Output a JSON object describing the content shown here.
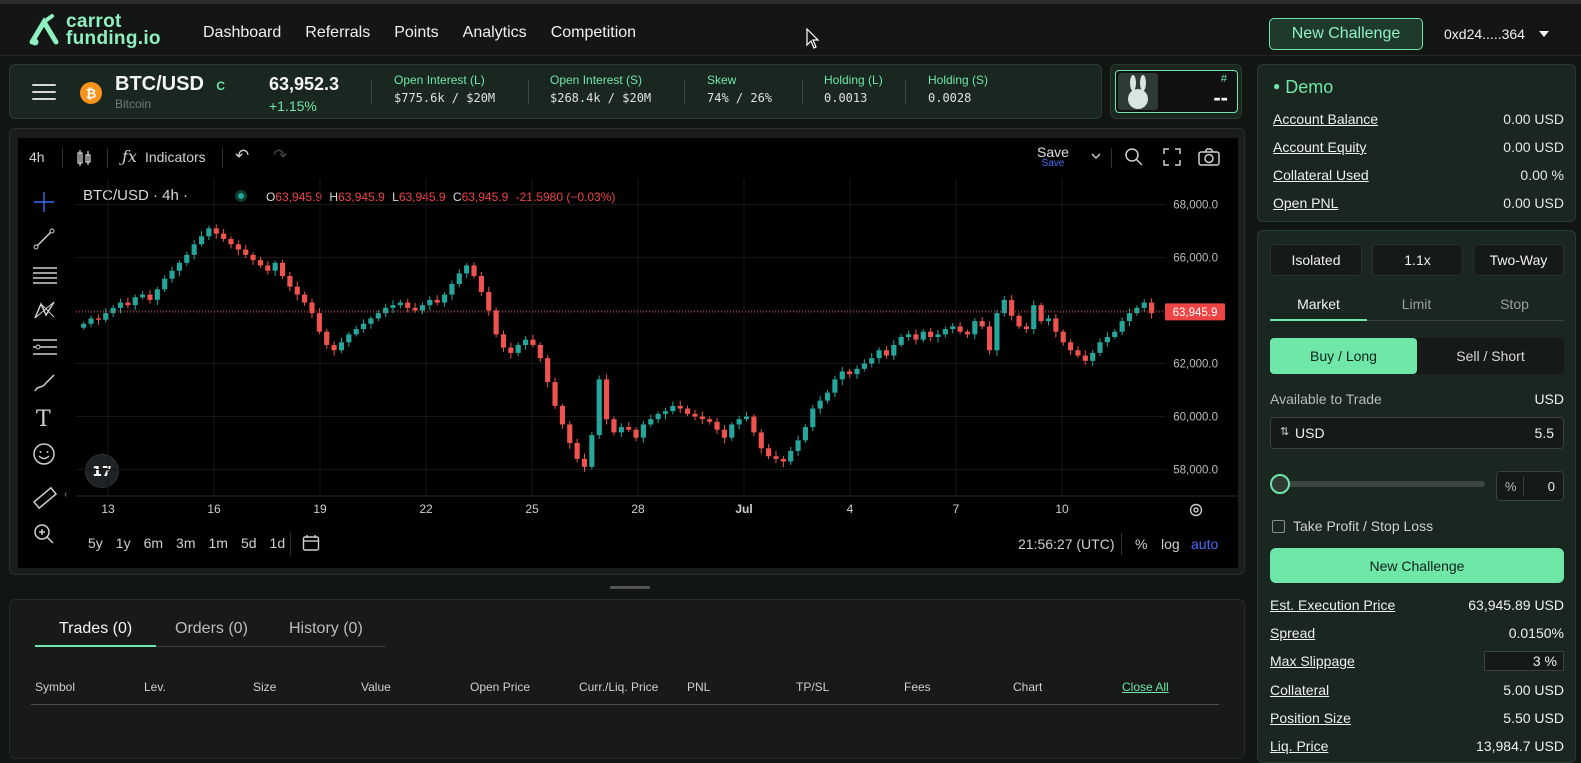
{
  "brand": {
    "line1": "carrot",
    "line2": "funding.io"
  },
  "nav": [
    "Dashboard",
    "Referrals",
    "Points",
    "Analytics",
    "Competition"
  ],
  "header": {
    "new_challenge": "New Challenge",
    "wallet": "0xd24.....364"
  },
  "ticker": {
    "symbol": "BTC/USD",
    "tag": "C",
    "name": "Bitcoin",
    "price": "63,952.3",
    "change": "+1.15%",
    "stats": [
      {
        "label": "Open Interest (L)",
        "value": "$775.6k / $20M"
      },
      {
        "label": "Open Interest (S)",
        "value": "$268.4k / $20M"
      },
      {
        "label": "Skew",
        "value": "74% / 26%"
      },
      {
        "label": "Holding (L)",
        "value": "0.0013"
      },
      {
        "label": "Holding (S)",
        "value": "0.0028"
      }
    ]
  },
  "rank": {
    "hash": "#",
    "value": "--"
  },
  "chart_toolbar": {
    "interval": "4h",
    "indicators": "Indicators",
    "save": "Save",
    "save_sub": "Save"
  },
  "chart_data": {
    "type": "candlestick",
    "symbol_line": "BTC/USD · 4h ·",
    "ohlc": {
      "o_label": "O",
      "o": "63,945.9",
      "h_label": "H",
      "h": "63,945.9",
      "l_label": "L",
      "l": "63,945.9",
      "c_label": "C",
      "c": "63,945.9",
      "chg": "-21.5980 (−0.03%)"
    },
    "y_ticks": [
      "68,000.0",
      "66,000.0",
      "64,000.0",
      "62,000.0",
      "60,000.0",
      "58,000.0"
    ],
    "y_tick_values": [
      68000,
      66000,
      64000,
      62000,
      60000,
      58000
    ],
    "ylim": [
      57000,
      69000
    ],
    "x_ticks": [
      "13",
      "16",
      "19",
      "22",
      "25",
      "28",
      "Jul",
      "4",
      "7",
      "10"
    ],
    "last_price": "63,945.9",
    "last_price_value": 63945.9,
    "up_color": "#26a69a",
    "down_color": "#ef5350",
    "series_close": [
      63500,
      63700,
      63650,
      63900,
      64100,
      64300,
      64200,
      64500,
      64600,
      64400,
      64800,
      65200,
      65500,
      65800,
      66100,
      66500,
      66800,
      67100,
      66900,
      66700,
      66500,
      66300,
      66100,
      65900,
      65700,
      65500,
      65800,
      65300,
      64900,
      64600,
      64300,
      63900,
      63200,
      62700,
      62500,
      62800,
      63100,
      63300,
      63500,
      63700,
      63900,
      64100,
      64200,
      64300,
      64100,
      64000,
      64200,
      64400,
      64300,
      64600,
      65000,
      65400,
      65700,
      65300,
      64700,
      64000,
      63100,
      62600,
      62400,
      62700,
      62900,
      62700,
      62200,
      61300,
      60400,
      59700,
      59000,
      58400,
      58100,
      59300,
      61400,
      59900,
      59400,
      59600,
      59500,
      59200,
      59700,
      59900,
      60100,
      60200,
      60400,
      60300,
      60100,
      60000,
      59900,
      59800,
      59500,
      59200,
      59700,
      59900,
      60000,
      59400,
      58800,
      58500,
      58400,
      58300,
      58700,
      59100,
      59600,
      60300,
      60600,
      60900,
      61400,
      61700,
      61600,
      61800,
      62000,
      62200,
      62500,
      62300,
      62700,
      63000,
      63100,
      62900,
      63200,
      63000,
      63100,
      63300,
      63400,
      63200,
      63100,
      63600,
      63400,
      62500,
      63900,
      64400,
      63800,
      63400,
      63300,
      64200,
      63600,
      63700,
      63200,
      62800,
      62500,
      62300,
      62100,
      62400,
      62800,
      63000,
      63200,
      63600,
      63900,
      64100,
      64300,
      63900
    ]
  },
  "ranges": [
    "5y",
    "1y",
    "6m",
    "3m",
    "1m",
    "5d",
    "1d"
  ],
  "chart_footer": {
    "time": "21:56:27 (UTC)",
    "pct": "%",
    "log": "log",
    "auto": "auto"
  },
  "account": {
    "mode": "Demo",
    "rows": [
      {
        "k": "Account Balance",
        "v": "0.00 USD"
      },
      {
        "k": "Account Equity",
        "v": "0.00 USD"
      },
      {
        "k": "Collateral Used",
        "v": "0.00 %"
      },
      {
        "k": "Open PNL",
        "v": "0.00 USD"
      }
    ]
  },
  "order": {
    "margin": "Isolated",
    "leverage": "1.1x",
    "mode": "Two-Way",
    "tabs": [
      "Market",
      "Limit",
      "Stop"
    ],
    "buy": "Buy / Long",
    "sell": "Sell / Short",
    "available_label": "Available to Trade",
    "available_unit": "USD",
    "input_unit": "USD",
    "input_value": "5.5",
    "pct_symbol": "%",
    "pct_value": "0",
    "tpsl": "Take Profit / Stop Loss",
    "submit": "New Challenge",
    "details": [
      {
        "k": "Est. Execution Price",
        "v": "63,945.89 USD"
      },
      {
        "k": "Spread",
        "v": "0.0150%"
      },
      {
        "k": "Max Slippage",
        "v": "3 %"
      },
      {
        "k": "Collateral",
        "v": "5.00 USD"
      },
      {
        "k": "Position Size",
        "v": "5.50 USD"
      },
      {
        "k": "Liq. Price",
        "v": "13,984.7 USD"
      }
    ]
  },
  "trades": {
    "tabs": [
      "Trades (0)",
      "Orders (0)",
      "History (0)"
    ],
    "columns": [
      "Symbol",
      "Lev.",
      "Size",
      "Value",
      "Open Price",
      "Curr./Liq. Price",
      "PNL",
      "TP/SL",
      "Fees",
      "Chart"
    ],
    "close_all": "Close All"
  },
  "colors": {
    "accent": "#6ee7a8",
    "panel": "#1a2620",
    "negative": "#ef4444"
  }
}
